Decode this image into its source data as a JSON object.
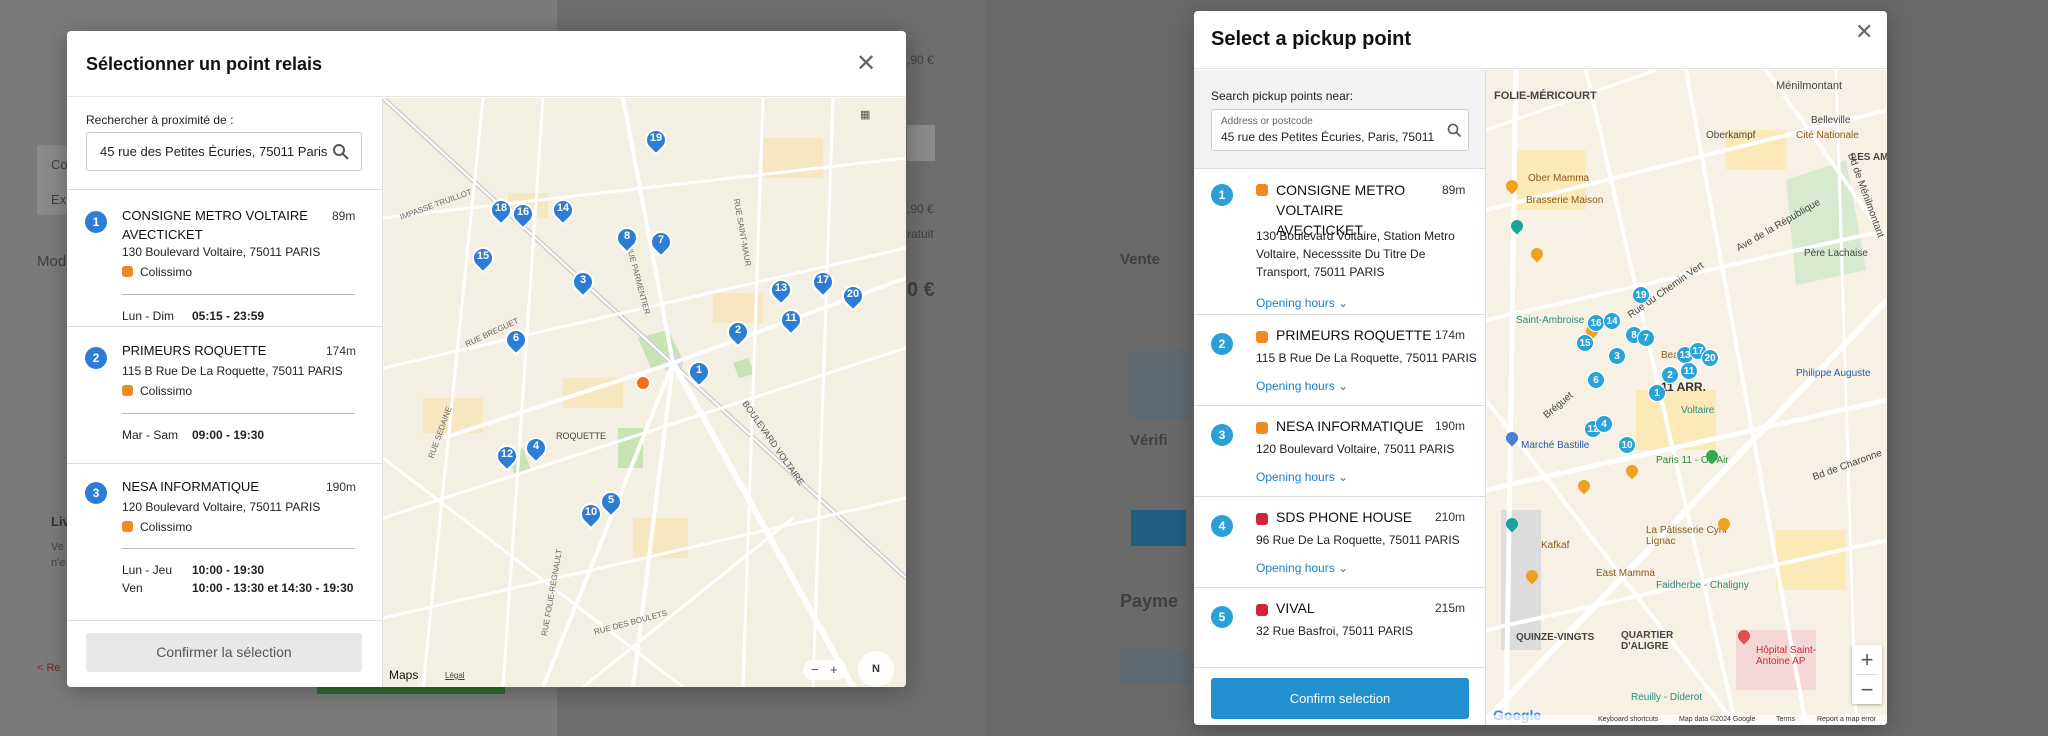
{
  "left_background": {
    "frags": [
      "Co",
      "Exp",
      "Mod",
      "Liv",
      "Ve",
      "n'e",
      "< Re",
      ",90 €",
      ",90 €",
      "ratuit",
      "0 €"
    ]
  },
  "right_background": {
    "frags": [
      "Vente",
      "Payme",
      "Vérifi"
    ]
  },
  "fr_modal": {
    "title": "Sélectionner un point relais",
    "search_label": "Rechercher à proximité de :",
    "search_value": "45 rue des Petites Écuries, 75011 Paris",
    "confirm_label": "Confirmer la sélection",
    "items": [
      {
        "num": "1",
        "name": "CONSIGNE METRO VOLTAIRE AVECTICKET",
        "dist": "89m",
        "address": "130 Boulevard Voltaire, 75011 PARIS",
        "carrier": "Colissimo",
        "hours": [
          {
            "days": "Lun - Dim",
            "time": "05:15 - 23:59"
          }
        ]
      },
      {
        "num": "2",
        "name": "PRIMEURS ROQUETTE",
        "dist": "174m",
        "address": "115 B Rue De La Roquette, 75011 PARIS",
        "carrier": "Colissimo",
        "hours": [
          {
            "days": "Mar - Sam",
            "time": "09:00 - 19:30"
          }
        ]
      },
      {
        "num": "3",
        "name": "NESA INFORMATIQUE",
        "dist": "190m",
        "address": "120 Boulevard Voltaire, 75011 PARIS",
        "carrier": "Colissimo",
        "hours": [
          {
            "days": "Lun - Jeu",
            "time": "10:00 - 19:30"
          },
          {
            "days": "Ven",
            "time": "10:00 - 13:30 et 14:30 - 19:30"
          }
        ]
      }
    ],
    "map": {
      "pins": [
        "19",
        "18",
        "16",
        "14",
        "8",
        "7",
        "15",
        "3",
        "13",
        "17",
        "20",
        "2",
        "11",
        "6",
        "1",
        "4",
        "12",
        "5",
        "10"
      ],
      "street_labels": [
        "IMPASSE TRUILLOT",
        "RUE SEDAINE",
        "BOULEVARD VOLTAIRE",
        "ROQUETTE",
        "RUE BREGUET",
        "AVENUE PARMENTIER",
        "RUE FOLIE-REGNAULT",
        "RUE DES BOULETS",
        "RUE SAINT-MAUR"
      ],
      "brand": "Maps",
      "legal": "Légal",
      "zoom_out": "−",
      "zoom_in": "+",
      "compass": "N"
    }
  },
  "en_modal": {
    "title": "Select a pickup point",
    "search_label": "Search pickup points near:",
    "search_float": "Address or postcode",
    "search_value": "45 rue des Petites Écuries, Paris, 75011",
    "confirm_label": "Confirm selection",
    "opening_hours_label": "Opening hours",
    "items": [
      {
        "num": "1",
        "name": "CONSIGNE METRO VOLTAIRE AVECTICKET",
        "dist": "89m",
        "address": "130 Boulevard Voltaire, Station Metro Voltaire, Necesssite Du Titre De Transport, 75011 PARIS",
        "badge": "orange"
      },
      {
        "num": "2",
        "name": "PRIMEURS ROQUETTE",
        "dist": "174m",
        "address": "115 B Rue De La Roquette, 75011 PARIS",
        "badge": "orange"
      },
      {
        "num": "3",
        "name": "NESA INFORMATIQUE",
        "dist": "190m",
        "address": "120 Boulevard Voltaire, 75011 PARIS",
        "badge": "orange"
      },
      {
        "num": "4",
        "name": "SDS PHONE HOUSE",
        "dist": "210m",
        "address": "96 Rue De La Roquette, 75011 PARIS",
        "badge": "red"
      },
      {
        "num": "5",
        "name": "VIVAL",
        "dist": "215m",
        "address": "32 Rue Basfroi, 75011 PARIS",
        "badge": "red"
      }
    ],
    "map": {
      "pins": [
        "19",
        "16",
        "14",
        "8",
        "7",
        "15",
        "3",
        "13",
        "17",
        "20",
        "2",
        "11",
        "1",
        "6",
        "12",
        "4",
        "10"
      ],
      "labels": [
        "FOLIE-MÉRICOURT",
        "Ménilmontant",
        "LES AMA",
        "Oberkampf",
        "Belleville",
        "Bd de Ménilmontant",
        "Brasserie Maison",
        "Ave de la République",
        "Père Lachaise",
        "Saint-Ambroise",
        "Rue du Chemin Vert",
        "Bréguet",
        "Beaux Arts",
        "11 ARR.",
        "Philippe Auguste",
        "Marché Bastille",
        "Paris 11 - On Air",
        "Bd de Charonne",
        "Kafkaf",
        "La Pâtisserie Cyril Lignac",
        "Faidherbe - Chaligny",
        "QUINZE-VINGTS",
        "QUARTIER D'ALIGRE",
        "Hôpital Saint-Antoine AP",
        "Reuilly - Diderot",
        "Ober Mamma",
        "East Mamma",
        "Cité Nationale",
        "Voltaire"
      ],
      "zoom_in": "+",
      "zoom_out": "−",
      "logo": "Google",
      "attributions": [
        "Keyboard shortcuts",
        "Map data ©2024 Google",
        "Terms",
        "Report a map error"
      ]
    }
  }
}
